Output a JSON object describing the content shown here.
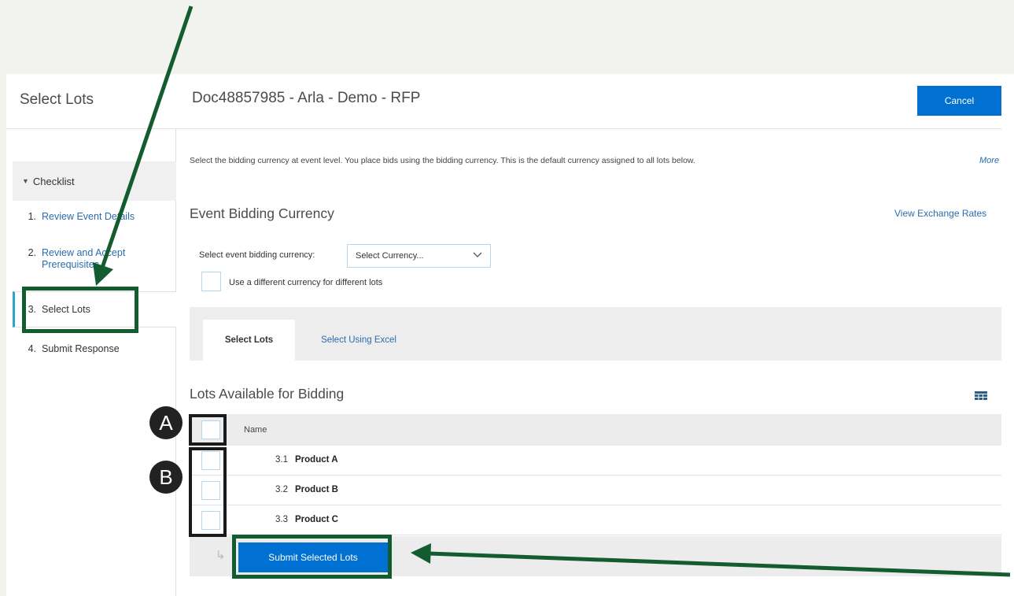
{
  "header": {
    "panel_title": "Select Lots",
    "doc_title": "Doc48857985 - Arla - Demo - RFP",
    "cancel_label": "Cancel"
  },
  "sidebar": {
    "checklist_label": "Checklist",
    "steps": [
      {
        "num": "1.",
        "label": "Review Event Details"
      },
      {
        "num": "2.",
        "label": "Review and Accept Prerequisites"
      },
      {
        "num": "3.",
        "label": "Select Lots"
      },
      {
        "num": "4.",
        "label": "Submit Response"
      }
    ]
  },
  "main": {
    "intro": "Select the bidding currency at event level. You place bids using the bidding currency. This is the default currency assigned to all lots below.",
    "more_label": "More",
    "currency_section_title": "Event Bidding Currency",
    "view_rates_label": "View Exchange Rates",
    "currency_label": "Select event bidding currency:",
    "currency_select_value": "Select Currency...",
    "diff_currency_label": "Use a different currency for different lots",
    "tabs": [
      {
        "label": "Select Lots"
      },
      {
        "label": "Select Using Excel"
      }
    ],
    "lots_title": "Lots Available for Bidding",
    "table": {
      "name_header": "Name",
      "rows": [
        {
          "num": "3.1",
          "name": "Product A"
        },
        {
          "num": "3.2",
          "name": "Product B"
        },
        {
          "num": "3.3",
          "name": "Product C"
        }
      ]
    },
    "submit_label": "Submit Selected Lots"
  },
  "annotations": {
    "marker_a": "A",
    "marker_b": "B",
    "highlight_color": "#135c2f"
  }
}
